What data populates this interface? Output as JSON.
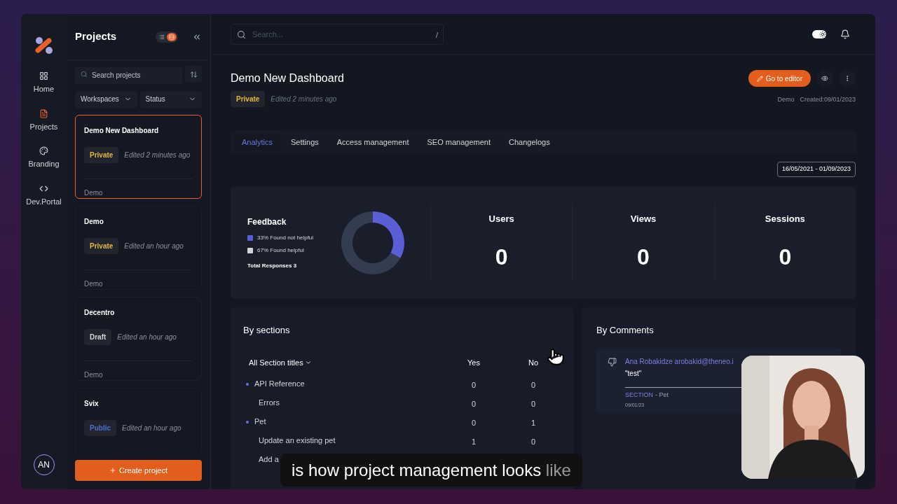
{
  "rail": {
    "items": [
      {
        "label": "Home",
        "kind": "home",
        "selected": false
      },
      {
        "label": "Projects",
        "kind": "projects",
        "selected": true
      },
      {
        "label": "Branding",
        "kind": "branding",
        "selected": false
      },
      {
        "label": "Dev.Portal",
        "kind": "code",
        "selected": false
      }
    ],
    "avatar": "AN"
  },
  "projects_panel": {
    "title": "Projects",
    "view_toggle": [
      {
        "kind": "list",
        "selected": false
      },
      {
        "kind": "grid",
        "selected": true
      }
    ],
    "search": {
      "placeholder": "Search projects"
    },
    "filters": [
      "Workspaces",
      "Status"
    ],
    "cards": [
      {
        "name": "Demo New Dashboard",
        "status": "Private",
        "color": "#e5b93a",
        "edited": "Edited 2 minutes ago",
        "workspace": "Demo",
        "selected": true
      },
      {
        "name": "Demo",
        "status": "Private",
        "color": "#e5b93a",
        "edited": "Edited an hour ago",
        "workspace": "Demo",
        "selected": false
      },
      {
        "name": "Decentro",
        "status": "Draft",
        "color": "#d4d4d8",
        "edited": "Edited an hour ago",
        "workspace": "Demo",
        "selected": false
      },
      {
        "name": "Svix",
        "status": "Public",
        "color": "#4c6fd6",
        "edited": "Edited an hour ago",
        "selected": false
      }
    ],
    "create_button": "Create project"
  },
  "topbar": {
    "search": {
      "placeholder": "Search...",
      "shortcut": "/"
    },
    "theme_toggle": {
      "on": true
    }
  },
  "project": {
    "title": "Demo New Dashboard",
    "status": "Private",
    "color": "#e5b93a",
    "edited": "Edited 2 minutes ago",
    "editor_button": "Go to editor",
    "workspace": "Demo",
    "created": "Created:09/01/2023"
  },
  "tabs": [
    {
      "label": "Analytics",
      "selected": true
    },
    {
      "label": "Settings",
      "selected": false
    },
    {
      "label": "Access management",
      "selected": false
    },
    {
      "label": "SEO management",
      "selected": false
    },
    {
      "label": "Changelogs",
      "selected": false
    }
  ],
  "date_range": "16/05/2021 - 01/09/2023",
  "feedback": {
    "title": "Feedback",
    "legend": [
      {
        "percent": "33%",
        "color": "#5a5fd6"
      },
      {
        "percent": "67%",
        "color": "#d4d4d8"
      }
    ],
    "total": "Total Responses 3",
    "chart_data": {
      "type": "donut",
      "categories": [
        "Found not helpful",
        "Found helpful"
      ],
      "values": [
        33,
        67
      ]
    }
  },
  "stats": [
    {
      "label": "Users",
      "value": "0"
    },
    {
      "label": "Views",
      "value": "0"
    },
    {
      "label": "Sessions",
      "value": "0"
    }
  ],
  "by_sections": {
    "title": "By sections",
    "columns": [
      "All Section titles",
      "Yes",
      "No"
    ],
    "rows": [
      {
        "title": "API Reference",
        "yes": "0",
        "no": "0",
        "children": [
          {
            "title": "Errors",
            "yes": "0",
            "no": "0"
          }
        ]
      },
      {
        "title": "Pet",
        "yes": "0",
        "no": "1",
        "children": [
          {
            "title": "Update an existing pet",
            "yes": "1",
            "no": "0"
          },
          {
            "title": "Add a"
          }
        ]
      }
    ]
  },
  "by_comments": {
    "title": "By Comments",
    "comments": [
      {
        "author": "Ana Robakidze arobakid@theneo.i",
        "text": "\"test\"",
        "section_tag": "SECTION",
        "section": "- Pet",
        "date": "09/01/23"
      }
    ]
  },
  "caption": {
    "spoken": "is how project management looks",
    "upcoming": "like"
  }
}
